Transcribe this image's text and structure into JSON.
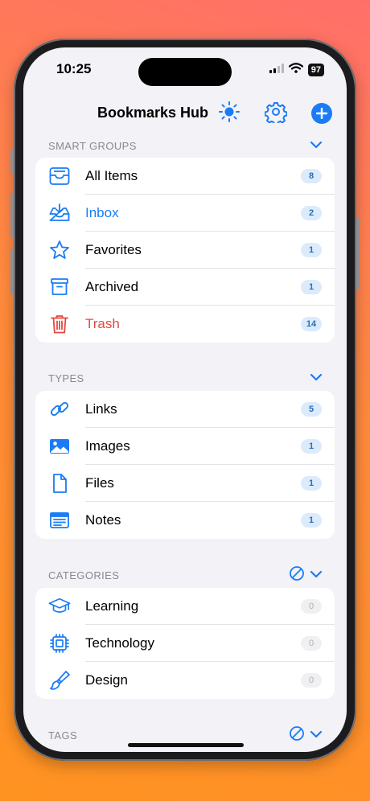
{
  "status_bar": {
    "time": "10:25",
    "battery": "97"
  },
  "nav": {
    "title": "Bookmarks Hub"
  },
  "colors": {
    "accent": "#1a7cf5",
    "danger": "#e5483e",
    "badge_bg": "#dcebfb"
  },
  "smart_groups": {
    "title": "SMART GROUPS",
    "items": [
      {
        "label": "All Items",
        "count": "8",
        "icon": "tray-icon"
      },
      {
        "label": "Inbox",
        "count": "2",
        "icon": "inbox-download-icon"
      },
      {
        "label": "Favorites",
        "count": "1",
        "icon": "star-icon"
      },
      {
        "label": "Archived",
        "count": "1",
        "icon": "archive-box-icon"
      },
      {
        "label": "Trash",
        "count": "14",
        "icon": "trash-icon"
      }
    ]
  },
  "types": {
    "title": "TYPES",
    "items": [
      {
        "label": "Links",
        "count": "5",
        "icon": "link-icon"
      },
      {
        "label": "Images",
        "count": "1",
        "icon": "image-icon"
      },
      {
        "label": "Files",
        "count": "1",
        "icon": "file-icon"
      },
      {
        "label": "Notes",
        "count": "1",
        "icon": "notes-icon"
      }
    ]
  },
  "categories": {
    "title": "CATEGORIES",
    "items": [
      {
        "label": "Learning",
        "count": "0",
        "icon": "graduation-cap-icon"
      },
      {
        "label": "Technology",
        "count": "0",
        "icon": "cpu-chip-icon"
      },
      {
        "label": "Design",
        "count": "0",
        "icon": "paintbrush-icon"
      }
    ]
  },
  "tags": {
    "title": "TAGS"
  }
}
